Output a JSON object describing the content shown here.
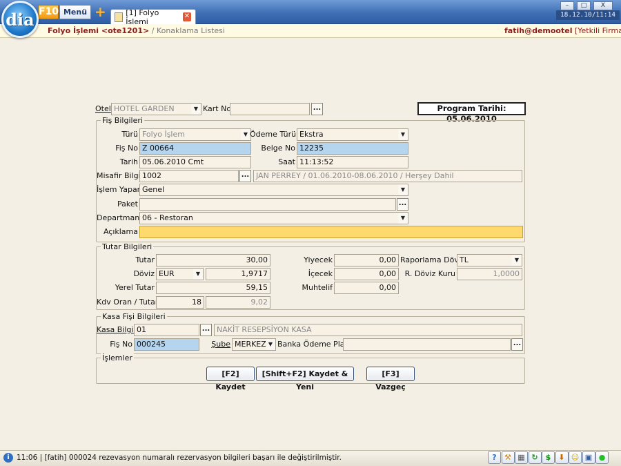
{
  "app": {
    "logo_text": "dia",
    "f10_label": "F10",
    "menu_label": "Menü",
    "add_tab_glyph": "+",
    "tab_label": "[1] Folyo İşlemi",
    "clock": "18.12.10/11:14",
    "window_buttons": [
      "–",
      "□",
      "X"
    ]
  },
  "breadcrumb": {
    "current": "Folyo İşlemi <ote1201>",
    "separator": "/",
    "parent": "Konaklama Listesi"
  },
  "user": {
    "name": "fatih@demootel",
    "firms_link": "[Yetkili Firmalar]"
  },
  "header": {
    "otel_label": "Otel",
    "otel_value": "HOTEL GARDEN",
    "kartno_label": "Kart No",
    "kartno_value": "",
    "program_date": "Program Tarihi: 05.06.2010"
  },
  "fis": {
    "title": "Fiş Bilgileri",
    "turu_label": "Türü",
    "turu_value": "Folyo İşlem",
    "odeme_label": "Ödeme Türü",
    "odeme_value": "Ekstra",
    "fisno_label": "Fiş No",
    "fisno_value": "Z 00664",
    "belgeno_label": "Belge No",
    "belgeno_value": "12235",
    "tarih_label": "Tarih",
    "tarih_value": "05.06.2010 Cmt",
    "saat_label": "Saat",
    "saat_value": "11:13:52",
    "misafir_label": "Misafir Bilgisi",
    "misafir_value": "1002",
    "misafir_desc": "JAN PERREY / 01.06.2010-08.06.2010 / Herşey Dahil",
    "islemyapan_label": "İşlem Yapan",
    "islemyapan_value": "Genel",
    "paket_label": "Paket",
    "paket_value": "",
    "departman_label": "Departman",
    "departman_value": "06 - Restoran",
    "aciklama_label": "Açıklama",
    "aciklama_value": ""
  },
  "tutar": {
    "title": "Tutar Bilgileri",
    "tutar_label": "Tutar",
    "tutar_value": "30,00",
    "doviz_label": "Döviz",
    "doviz_value": "EUR",
    "doviz_rate": "1,9717",
    "yerel_label": "Yerel Tutar",
    "yerel_value": "59,15",
    "kdv_label": "Kdv Oran / Tutar",
    "kdv_oran": "18",
    "kdv_tutar": "9,02",
    "yiyecek_label": "Yiyecek",
    "yiyecek_value": "0,00",
    "icecek_label": "İçecek",
    "icecek_value": "0,00",
    "muhtelif_label": "Muhtelif",
    "muhtelif_value": "0,00",
    "rapor_label": "Raporlama Dövizi",
    "rapor_value": "TL",
    "rkur_label": "R. Döviz Kuru",
    "rkur_value": "1,0000"
  },
  "kasa": {
    "title": "Kasa Fişi Bilgileri",
    "kasa_label": "Kasa Bilgisi",
    "kasa_value": "01",
    "kasa_desc": "NAKİT RESEPSİYON KASA",
    "fisno_label": "Fiş No",
    "fisno_value": "000245",
    "sube_label": "Şube",
    "sube_value": "MERKEZ",
    "banka_label": "Banka Ödeme Planı",
    "banka_value": ""
  },
  "islemler": {
    "title": "İşlemler",
    "save": "[F2] Kaydet",
    "save_new": "[Shift+F2] Kaydet & Yeni",
    "cancel": "[F3] Vazgeç"
  },
  "status": {
    "icon": "i",
    "text": "11:06 | [fatih] 000024 rezevasyon numaralı rezervasyon bilgileri başarı ile değiştirilmiştir."
  },
  "tray": [
    {
      "name": "help-icon",
      "glyph": "?",
      "color": "#2f6fc4"
    },
    {
      "name": "tools-icon",
      "glyph": "⚒",
      "color": "#c98a1b"
    },
    {
      "name": "calculator-icon",
      "glyph": "▦",
      "color": "#555"
    },
    {
      "name": "refresh-icon",
      "glyph": "↻",
      "color": "#2a8a2a"
    },
    {
      "name": "currency-icon",
      "glyph": "$",
      "color": "#1c8b1c"
    },
    {
      "name": "download-icon",
      "glyph": "⬇",
      "color": "#c96c00"
    },
    {
      "name": "smiley-icon",
      "glyph": "☺",
      "color": "#c9a200"
    },
    {
      "name": "lock-icon",
      "glyph": "▣",
      "color": "#2f5ea6"
    },
    {
      "name": "online-status-icon",
      "glyph": "●",
      "color": "#22c022"
    }
  ],
  "glyphs": {
    "dropdown": "▼",
    "ellipsis": "..."
  }
}
